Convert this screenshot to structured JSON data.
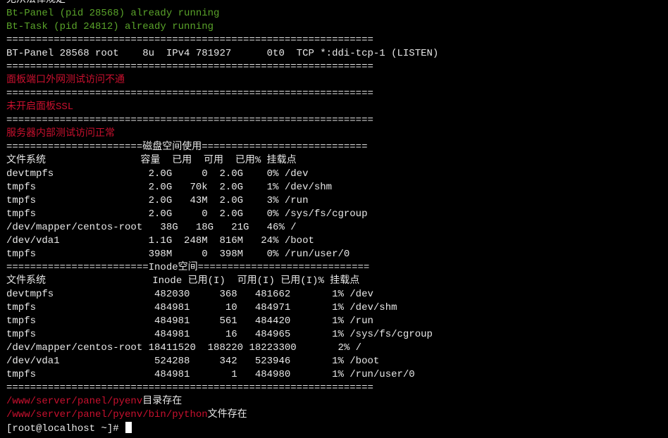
{
  "terminal": {
    "lines": [
      {
        "text": "无从法律规定",
        "color": "white"
      },
      {
        "text": "Bt-Panel (pid 28568) already running",
        "color": "green"
      },
      {
        "text": "Bt-Task (pid 24812) already running",
        "color": "green"
      },
      {
        "text": "==============================================================",
        "color": "white"
      },
      {
        "text": "BT-Panel 28568 root    8u  IPv4 781927      0t0  TCP *:ddi-tcp-1 (LISTEN)",
        "color": "white"
      },
      {
        "text": "==============================================================",
        "color": "white"
      },
      {
        "text": "面板端口外网测试访问不通",
        "color": "red"
      },
      {
        "text": "==============================================================",
        "color": "white"
      },
      {
        "text": "未开启面板SSL",
        "color": "red"
      },
      {
        "text": "==============================================================",
        "color": "white"
      },
      {
        "text": "服务器内部测试访问正常",
        "color": "red"
      },
      {
        "text": "=======================磁盘空间使用============================",
        "color": "white"
      },
      {
        "text": "文件系统                容量  已用  可用  已用% 挂载点",
        "color": "white"
      },
      {
        "text": "devtmpfs                2.0G     0  2.0G    0% /dev",
        "color": "white"
      },
      {
        "text": "tmpfs                   2.0G   70k  2.0G    1% /dev/shm",
        "color": "white"
      },
      {
        "text": "tmpfs                   2.0G   43M  2.0G    3% /run",
        "color": "white"
      },
      {
        "text": "tmpfs                   2.0G     0  2.0G    0% /sys/fs/cgroup",
        "color": "white"
      },
      {
        "text": "/dev/mapper/centos-root   38G   18G   21G   46% /",
        "color": "white"
      },
      {
        "text": "/dev/vda1               1.1G  248M  816M   24% /boot",
        "color": "white"
      },
      {
        "text": "tmpfs                   398M     0  398M    0% /run/user/0",
        "color": "white"
      },
      {
        "text": "========================Inode空间=============================",
        "color": "white"
      },
      {
        "text": "文件系统                  Inode 已用(I)  可用(I) 已用(I)% 挂载点",
        "color": "white"
      },
      {
        "text": "devtmpfs                 482030     368   481662       1% /dev",
        "color": "white"
      },
      {
        "text": "tmpfs                    484981      10   484971       1% /dev/shm",
        "color": "white"
      },
      {
        "text": "tmpfs                    484981     561   484420       1% /run",
        "color": "white"
      },
      {
        "text": "tmpfs                    484981      16   484965       1% /sys/fs/cgroup",
        "color": "white"
      },
      {
        "text": "/dev/mapper/centos-root 18411520  188220 18223300       2% /",
        "color": "white"
      },
      {
        "text": "/dev/vda1                524288     342   523946       1% /boot",
        "color": "white"
      },
      {
        "text": "tmpfs                    484981       1   484980       1% /run/user/0",
        "color": "white"
      },
      {
        "text": "==============================================================",
        "color": "white"
      }
    ],
    "pyenv_dir": {
      "path": "/www/server/panel/pyenv",
      "suffix": "目录存在"
    },
    "python_file": {
      "path": "/www/server/panel/pyenv/bin/python",
      "suffix": "文件存在"
    },
    "prompt": "[root@localhost ~]# "
  },
  "colors": {
    "background": "#000000",
    "text": "#e8e8e8",
    "success": "#5aa32a",
    "error": "#c8102e",
    "cursor": "#ffffff"
  }
}
